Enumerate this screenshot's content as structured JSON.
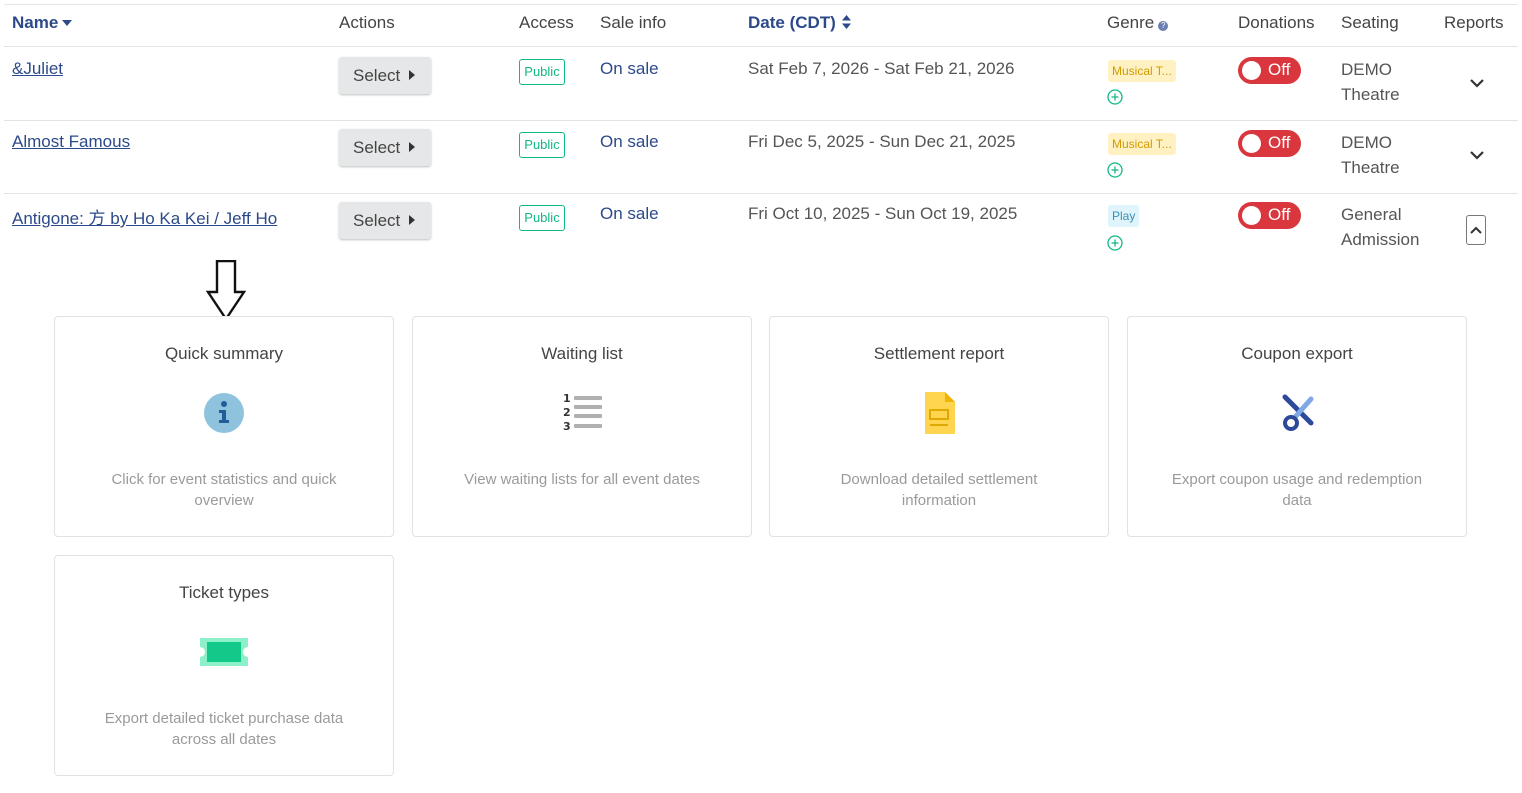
{
  "table": {
    "headers": {
      "name": "Name",
      "actions": "Actions",
      "access": "Access",
      "sale_info": "Sale info",
      "date": "Date (CDT)",
      "genre": "Genre",
      "genre_help": "?",
      "donations": "Donations",
      "seating": "Seating",
      "reports": "Reports"
    },
    "rows": [
      {
        "name": "&Juliet",
        "action": "Select",
        "access": "Public",
        "sale_info": "On sale",
        "date": "Sat Feb 7, 2026 - Sat Feb 21, 2026",
        "genre": "Musical T...",
        "donations": "Off",
        "seating_line1": "DEMO",
        "seating_line2": "Theatre"
      },
      {
        "name": "Almost Famous",
        "action": "Select",
        "access": "Public",
        "sale_info": "On sale",
        "date": "Fri Dec 5, 2025 - Sun Dec 21, 2025",
        "genre": "Musical T...",
        "donations": "Off",
        "seating_line1": "DEMO",
        "seating_line2": "Theatre"
      },
      {
        "name": "Antigone: 方 by Ho Ka Kei / Jeff Ho",
        "action": "Select",
        "access": "Public",
        "sale_info": "On sale",
        "date": "Fri Oct 10, 2025 - Sun Oct 19, 2025",
        "genre": "Play",
        "donations": "Off",
        "seating_line1": "General",
        "seating_line2": "Admission"
      }
    ]
  },
  "reports": [
    {
      "title": "Quick summary",
      "icon": "info-icon",
      "description": "Click for event statistics and quick overview"
    },
    {
      "title": "Waiting list",
      "icon": "numbered-list-icon",
      "description": "View waiting lists for all event dates"
    },
    {
      "title": "Settlement report",
      "icon": "document-icon",
      "description": "Download detailed settlement information"
    },
    {
      "title": "Coupon export",
      "icon": "scissors-icon",
      "description": "Export coupon usage and redemption data"
    },
    {
      "title": "Ticket types",
      "icon": "ticket-icon",
      "description": "Export detailed ticket purchase data across all dates"
    }
  ],
  "colors": {
    "accent": "#2c4a8a",
    "public": "#12b886",
    "toggle_off": "#d9363e",
    "musical_bg": "#fff1c2",
    "play_bg": "#dff4fb"
  }
}
